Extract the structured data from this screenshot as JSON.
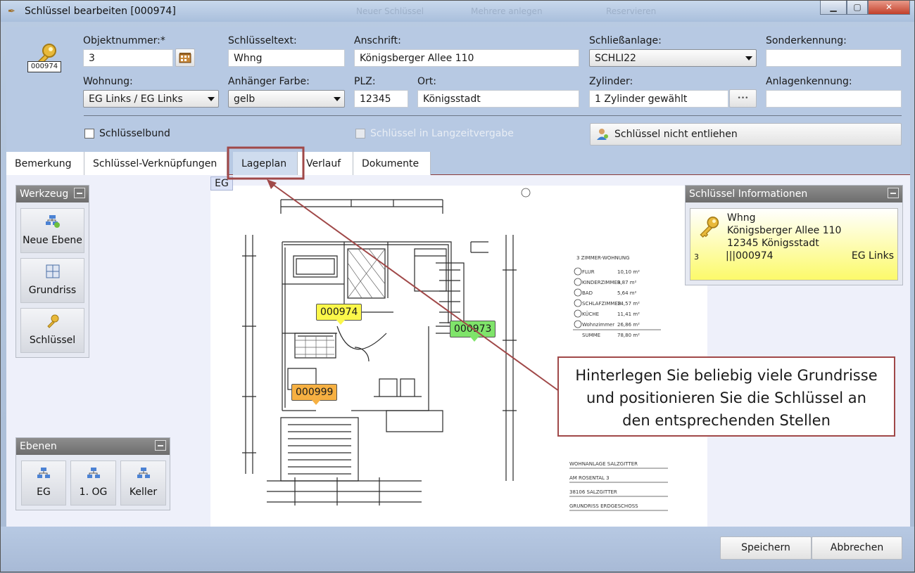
{
  "window": {
    "title": "Schlüssel bearbeiten [000974]",
    "bg_faded": [
      "Neuer Schlüssel",
      "Mehrere anlegen",
      "Reservieren"
    ]
  },
  "header": {
    "key_badge": "000974",
    "objektnummer": {
      "label": "Objektnummer:*",
      "value": "3"
    },
    "schluesseltext": {
      "label": "Schlüsseltext:",
      "value": "Whng"
    },
    "anschrift": {
      "label": "Anschrift:",
      "value": "Königsberger Allee 110"
    },
    "schliessanlage": {
      "label": "Schließanlage:",
      "value": "SCHLI22"
    },
    "sonderkennung": {
      "label": "Sonderkennung:",
      "value": ""
    },
    "wohnung": {
      "label": "Wohnung:",
      "value": "EG Links / EG Links"
    },
    "anhaenger": {
      "label": "Anhänger Farbe:",
      "value": "gelb"
    },
    "plz": {
      "label": "PLZ:",
      "value": "12345"
    },
    "ort": {
      "label": "Ort:",
      "value": "Königsstadt"
    },
    "zylinder": {
      "label": "Zylinder:",
      "value": "1 Zylinder gewählt",
      "more": "•••"
    },
    "anlagenkennung": {
      "label": "Anlagenkennung:",
      "value": ""
    },
    "schluesselbund": "Schlüsselbund",
    "langzeit": "Schlüssel in Langzeitvergabe",
    "nicht_entliehen": "Schlüssel nicht entliehen"
  },
  "tabs": [
    "Bemerkung",
    "Schlüssel-Verknüpfungen",
    "Lageplan",
    "Verlauf",
    "Dokumente"
  ],
  "werkzeug": {
    "title": "Werkzeug",
    "items": [
      "Neue Ebene",
      "Grundriss",
      "Schlüssel"
    ]
  },
  "ebenen": {
    "title": "Ebenen",
    "items": [
      "EG",
      "1. OG",
      "Keller"
    ]
  },
  "plan": {
    "level": "EG",
    "markers": [
      {
        "id": "000974",
        "color": "#fbf74a"
      },
      {
        "id": "000973",
        "color": "#7fe46a"
      },
      {
        "id": "000999",
        "color": "#f6b042"
      }
    ]
  },
  "info": {
    "title": "Schlüssel Informationen",
    "line1": "Whng",
    "line2": "Königsberger Allee 110",
    "line3": "12345 Königsstadt",
    "num": "3",
    "code": "|||000974",
    "wohnung": "EG Links"
  },
  "callout": [
    "Hinterlegen Sie beliebig viele Grundrisse",
    "und positionieren Sie die Schlüssel an",
    "den entsprechenden Stellen"
  ],
  "footer": {
    "save": "Speichern",
    "cancel": "Abbrechen"
  },
  "colors": {
    "accent_red": "#a04848",
    "panel_bg": "#b7c9e3"
  }
}
